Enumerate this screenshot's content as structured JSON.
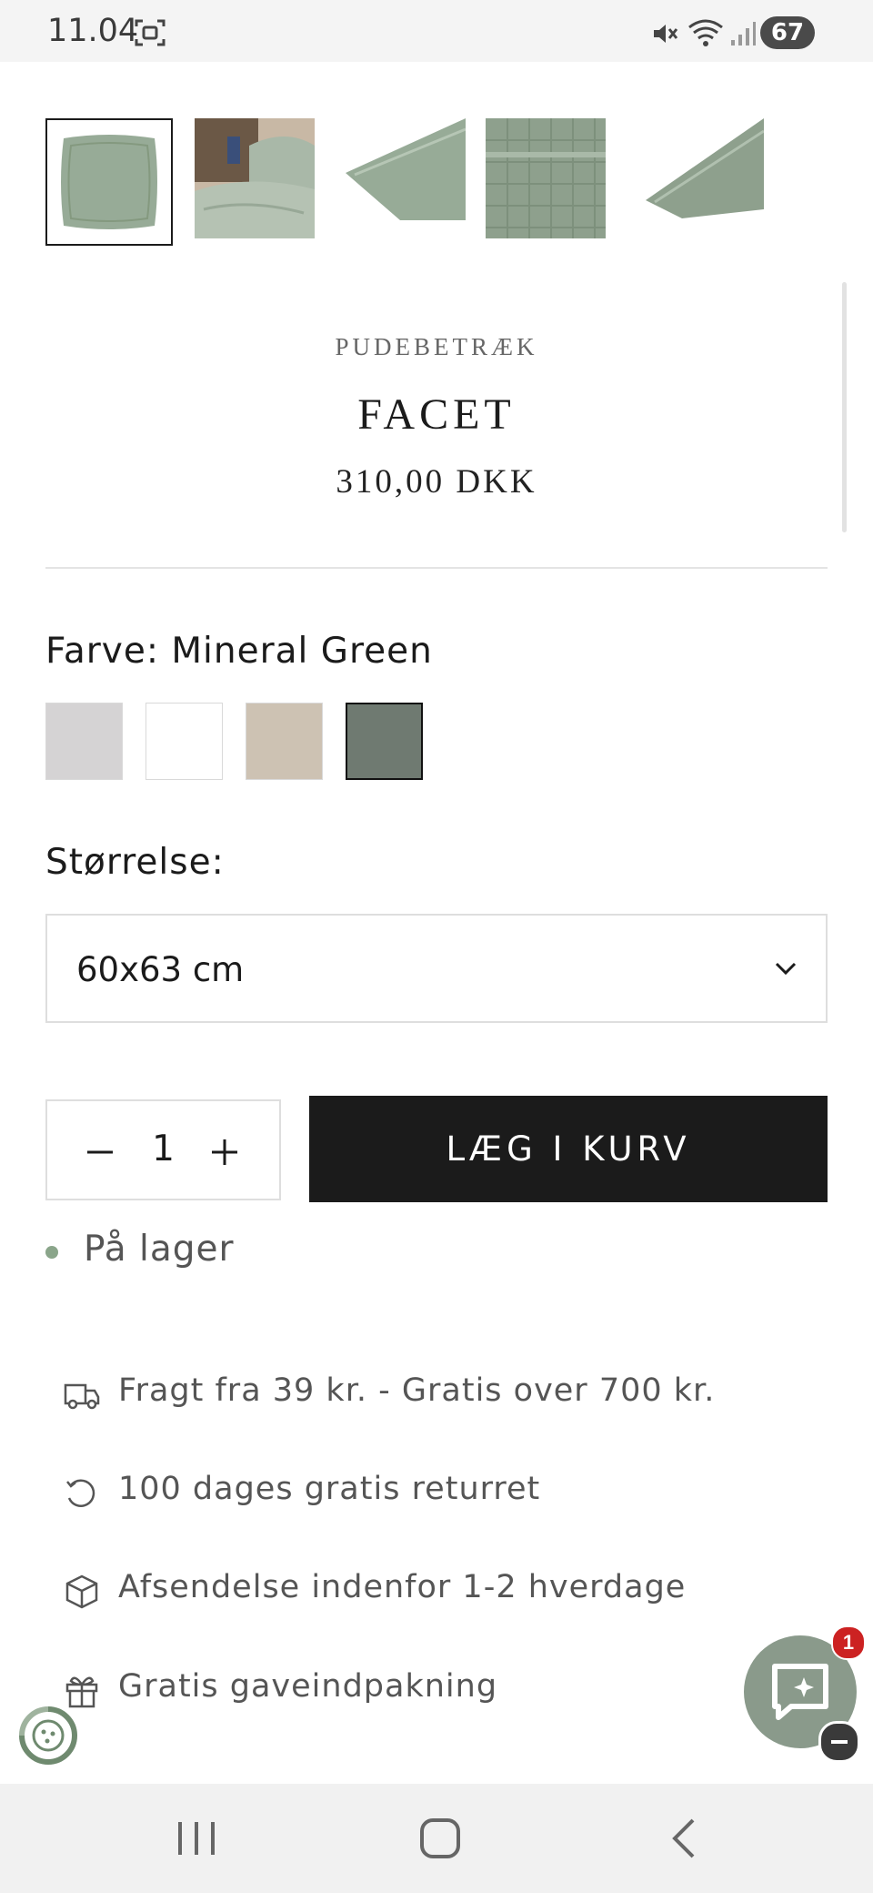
{
  "status_bar": {
    "time": "11.04",
    "battery": "67"
  },
  "gallery": {
    "thumbnails": [
      {
        "name": "thumbnail-pillow-front",
        "selected": true
      },
      {
        "name": "thumbnail-bedroom-scene",
        "selected": false
      },
      {
        "name": "thumbnail-pillow-corner",
        "selected": false
      },
      {
        "name": "thumbnail-fabric-closeup",
        "selected": false
      },
      {
        "name": "thumbnail-pillow-edge",
        "selected": false
      }
    ]
  },
  "product": {
    "category": "PUDEBETRÆK",
    "title": "FACET",
    "price": "310,00 DKK"
  },
  "color": {
    "label": "Farve: Mineral Green",
    "swatches": [
      {
        "name": "light-grey",
        "hex": "#d5d3d4",
        "selected": false
      },
      {
        "name": "white",
        "hex": "#ffffff",
        "selected": false
      },
      {
        "name": "sand",
        "hex": "#cdc2b3",
        "selected": false
      },
      {
        "name": "mineral-green",
        "hex": "#6f7a71",
        "selected": true
      }
    ]
  },
  "size": {
    "label": "Størrelse:",
    "selected": "60x63 cm"
  },
  "quantity": {
    "value": "1"
  },
  "add_to_cart": {
    "label": "LÆG I KURV"
  },
  "stock": {
    "text": "På lager",
    "dot_color": "#8aa58a"
  },
  "features": [
    {
      "icon": "truck-icon",
      "text": "Fragt fra 39 kr. - Gratis over 700 kr."
    },
    {
      "icon": "return-icon",
      "text": "100 dages gratis returret"
    },
    {
      "icon": "package-icon",
      "text": "Afsendelse indenfor 1-2 hverdage"
    },
    {
      "icon": "gift-icon",
      "text": "Gratis gaveindpakning"
    }
  ],
  "chat": {
    "badge": "1",
    "accent": "#8a9a8b"
  }
}
